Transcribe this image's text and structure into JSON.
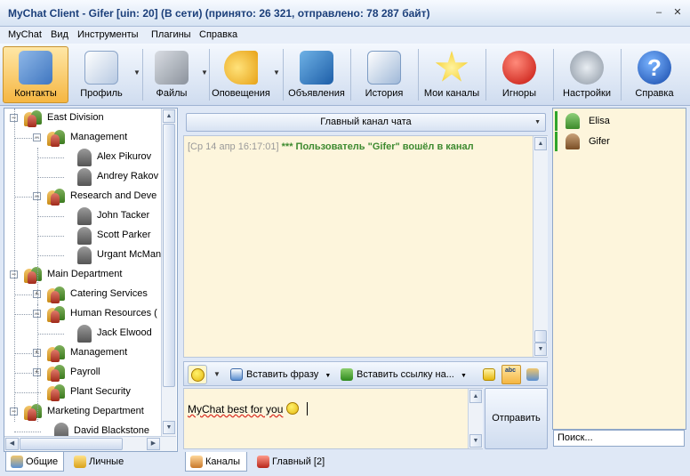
{
  "window": {
    "title": "MyChat Client - Gifer [uin: 20] (В сети) (принято: 26 321, отправлено: 78 287 байт)",
    "minimize_glyph": "–",
    "close_glyph": "✕"
  },
  "menu": [
    "MyChat",
    "Вид",
    "Инструменты",
    "Плагины",
    "Справка"
  ],
  "toolbar": {
    "buttons": [
      {
        "label": "Контакты",
        "icon": "contacts-icon"
      },
      {
        "label": "Профиль",
        "icon": "profile-icon"
      },
      {
        "label": "Файлы",
        "icon": "files-icon"
      },
      {
        "label": "Оповещения",
        "icon": "alerts-icon"
      },
      {
        "label": "Объявления",
        "icon": "announcements-icon"
      },
      {
        "label": "История",
        "icon": "history-icon"
      },
      {
        "label": "Мои каналы",
        "icon": "star-icon"
      },
      {
        "label": "Игноры",
        "icon": "stop-icon"
      },
      {
        "label": "Настройки",
        "icon": "settings-icon"
      },
      {
        "label": "Справка",
        "icon": "help-icon",
        "glyph": "?"
      }
    ],
    "active": "Контакты"
  },
  "contacts_tree": [
    {
      "label": "East Division",
      "type": "group",
      "level": 0,
      "expander": "−"
    },
    {
      "label": "Management",
      "type": "group",
      "level": 1,
      "expander": "−"
    },
    {
      "label": "Alex Pikurov",
      "type": "user",
      "level": 2
    },
    {
      "label": "Andrey Rakov",
      "type": "user",
      "level": 2
    },
    {
      "label": "Research and Deve",
      "type": "group",
      "level": 1,
      "expander": "−"
    },
    {
      "label": "John Tacker",
      "type": "user",
      "level": 2
    },
    {
      "label": "Scott Parker",
      "type": "user",
      "level": 2
    },
    {
      "label": "Urgant McMane",
      "type": "user",
      "level": 2
    },
    {
      "label": "Main Department",
      "type": "group",
      "level": 0,
      "expander": "−"
    },
    {
      "label": "Catering Services",
      "type": "group",
      "level": 1,
      "expander": "+"
    },
    {
      "label": "Human Resources (",
      "type": "group",
      "level": 1,
      "expander": "−"
    },
    {
      "label": "Jack Elwood",
      "type": "user",
      "level": 2
    },
    {
      "label": "Management",
      "type": "group",
      "level": 1,
      "expander": "+"
    },
    {
      "label": "Payroll",
      "type": "group",
      "level": 1,
      "expander": "+"
    },
    {
      "label": "Plant Security",
      "type": "group",
      "level": 1,
      "expander": ""
    },
    {
      "label": "Marketing Department",
      "type": "group",
      "level": 0,
      "expander": "−"
    },
    {
      "label": "David Blackstone",
      "type": "user",
      "level": 1
    }
  ],
  "left_tabs": [
    {
      "label": "Общие",
      "active": true
    },
    {
      "label": "Личные",
      "active": false
    }
  ],
  "channel": {
    "selected": "Главный канал чата",
    "messages": [
      {
        "time": "[Ср 14 апр 16:17:01]",
        "text": "*** Пользователь \"Gifer\" вошёл в канал"
      }
    ]
  },
  "chat_toolbar": {
    "insert_phrase": "Вставить фразу",
    "insert_link": "Вставить ссылку на...",
    "spell_label": "abc"
  },
  "input": {
    "text": "MyChat best for you"
  },
  "send_button": "Отправить",
  "center_tabs": [
    {
      "label": "Каналы",
      "active": true
    },
    {
      "label": "Главный [2]",
      "active": false
    }
  ],
  "users": [
    {
      "name": "Elisa",
      "color": "#5fae4a"
    },
    {
      "name": "Gifer",
      "color": "#9a6b3c"
    }
  ],
  "search": {
    "placeholder": "Поиск..."
  },
  "colors": {
    "accent_active": "#f5b642",
    "chat_background": "#fdf5dc",
    "system_message": "#3d8a2f",
    "online_bar": "#2fa52a"
  }
}
